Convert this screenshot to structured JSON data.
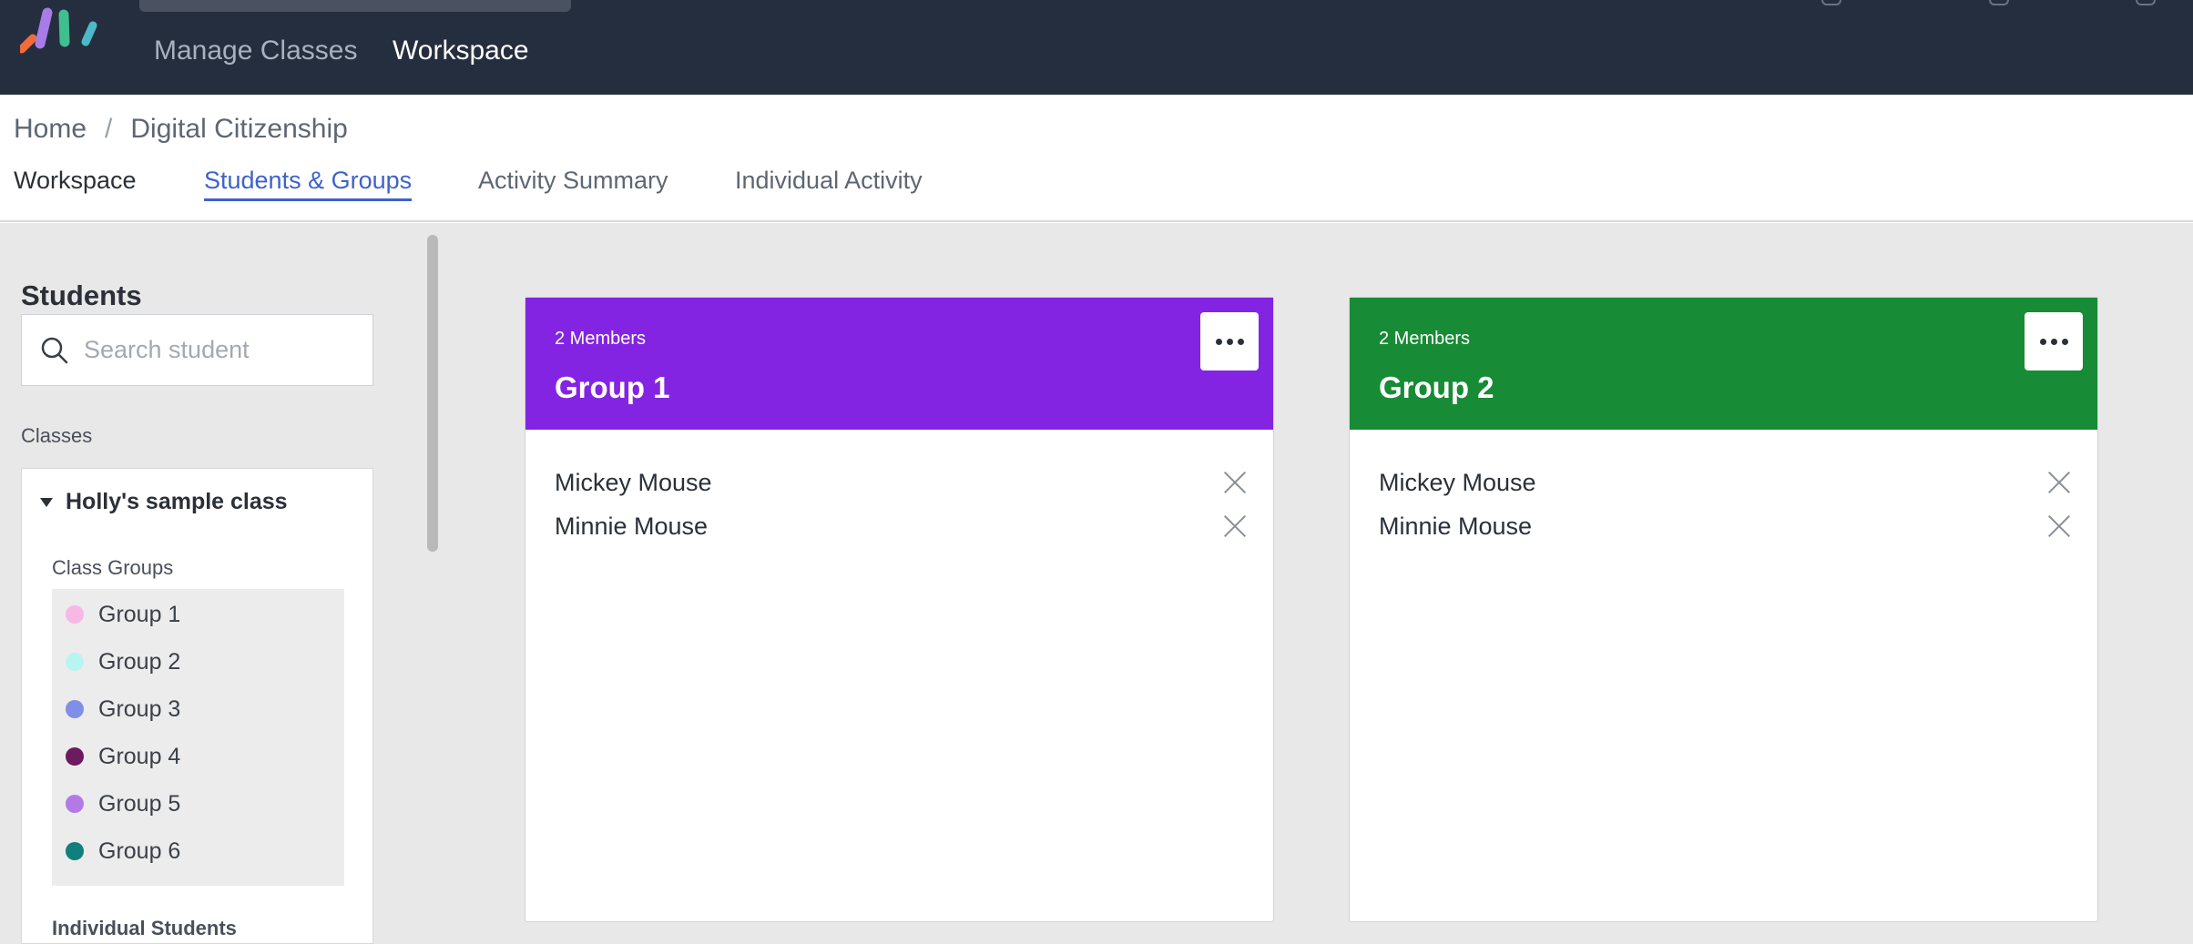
{
  "topnav": {
    "links": [
      "Manage Classes",
      "Workspace"
    ],
    "logo_colors": [
      "#f26b3a",
      "#a77be8",
      "#3fbf8f",
      "#4cb9c9"
    ]
  },
  "breadcrumb": [
    "Home",
    "Digital Citizenship"
  ],
  "subtabs": {
    "items": [
      "Workspace",
      "Students & Groups",
      "Activity Summary",
      "Individual Activity"
    ],
    "active": "Students & Groups"
  },
  "sidebar": {
    "title": "Students",
    "search_placeholder": "Search student",
    "classes_label": "Classes",
    "class_name": "Holly's sample class",
    "class_groups_label": "Class Groups",
    "class_groups": [
      {
        "label": "Group 1",
        "color": "#f7b8e6"
      },
      {
        "label": "Group 2",
        "color": "#b8f5f1"
      },
      {
        "label": "Group 3",
        "color": "#7f8fe8"
      },
      {
        "label": "Group 4",
        "color": "#6e1a5e"
      },
      {
        "label": "Group 5",
        "color": "#b37ae6"
      },
      {
        "label": "Group 6",
        "color": "#117f7c"
      }
    ],
    "individual_label": "Individual Students"
  },
  "groups": [
    {
      "members_label": "2 Members",
      "name": "Group 1",
      "color": "#8424e3",
      "members": [
        "Mickey Mouse",
        "Minnie Mouse"
      ]
    },
    {
      "members_label": "2 Members",
      "name": "Group 2",
      "color": "#178b35",
      "members": [
        "Mickey Mouse",
        "Minnie Mouse"
      ]
    }
  ]
}
